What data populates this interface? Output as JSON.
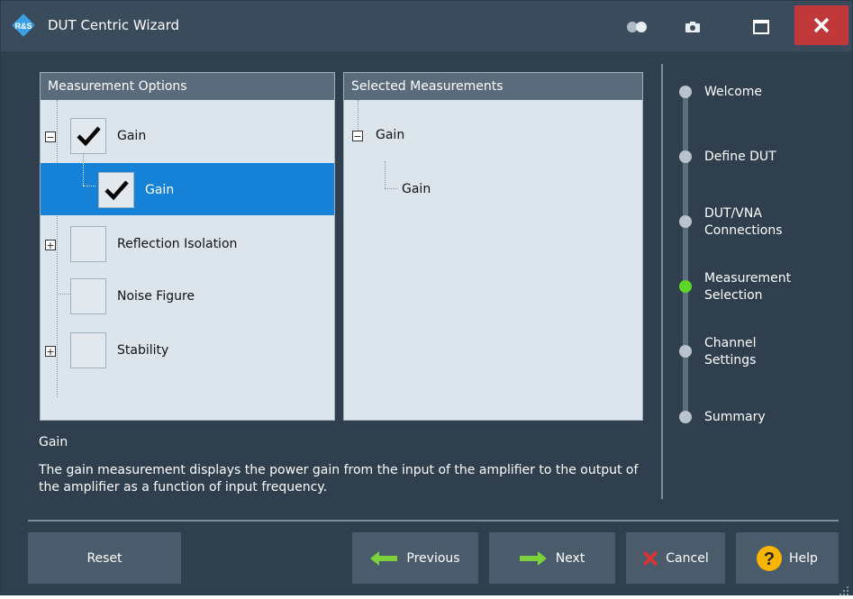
{
  "window": {
    "title": "DUT Centric Wizard"
  },
  "options_panel": {
    "header": "Measurement Options",
    "items": [
      {
        "label": "Gain",
        "checked": true,
        "expander": "−"
      },
      {
        "label": "Gain",
        "checked": true,
        "selected": true
      },
      {
        "label": "Reflection Isolation",
        "checked": false,
        "expander": "+"
      },
      {
        "label": "Noise Figure",
        "checked": false
      },
      {
        "label": "Stability",
        "checked": false,
        "expander": "+"
      }
    ]
  },
  "selected_panel": {
    "header": "Selected Measurements",
    "items": [
      {
        "label": "Gain",
        "expander": "−"
      },
      {
        "label": "Gain"
      }
    ]
  },
  "description": {
    "title": "Gain",
    "text": "The gain measurement displays the power gain from the input of the amplifier to the output of the amplifier as a function of input frequency."
  },
  "steps": [
    {
      "label": "Welcome"
    },
    {
      "label": "Define DUT"
    },
    {
      "label": "DUT/VNA Connections"
    },
    {
      "label": "Measurement Selection",
      "active": true
    },
    {
      "label": "Channel Settings"
    },
    {
      "label": "Summary"
    }
  ],
  "buttons": {
    "reset": "Reset",
    "previous": "Previous",
    "next": "Next",
    "cancel": "Cancel",
    "help": "Help"
  },
  "colors": {
    "accent_selected": "#1582d8",
    "step_active": "#5ed62a",
    "arrow_green": "#7bd23c",
    "cancel_red": "#e0312f",
    "help_yellow": "#f7b500",
    "close_red": "#c1383b"
  }
}
